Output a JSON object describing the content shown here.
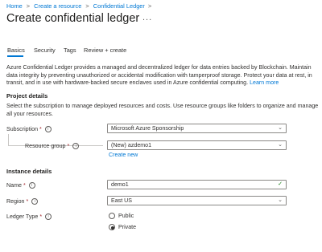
{
  "breadcrumb": {
    "items": [
      "Home",
      "Create a resource",
      "Confidential Ledger"
    ],
    "separator": ">",
    "trailing": ">"
  },
  "page": {
    "title": "Create confidential ledger",
    "more_actions": "..."
  },
  "tabs": [
    {
      "label": "Basics",
      "active": true
    },
    {
      "label": "Security",
      "active": false
    },
    {
      "label": "Tags",
      "active": false
    },
    {
      "label": "Review + create",
      "active": false
    }
  ],
  "description": {
    "text": "Azure Confidential Ledger provides a managed and decentralized ledger for data entries backed by Blockchain. Maintain data integrity by preventing unauthorized or accidental modification with tamperproof storage. Protect your data at rest, in transit, and in use with hardware-backed secure enclaves used in Azure confidential computing.",
    "learn_more": "Learn more"
  },
  "project_details": {
    "heading": "Project details",
    "text": "Select the subscription to manage deployed resources and costs. Use resource groups like folders to organize and manage all your resources.",
    "subscription": {
      "label": "Subscription",
      "value": "Microsoft Azure Sponsorship"
    },
    "resource_group": {
      "label": "Resource group",
      "value": "(New) azdemo1",
      "create_new": "Create new"
    }
  },
  "instance_details": {
    "heading": "Instance details",
    "name": {
      "label": "Name",
      "value": "demo1"
    },
    "region": {
      "label": "Region",
      "value": "East US"
    },
    "ledger_type": {
      "label": "Ledger Type",
      "options": [
        {
          "label": "Public",
          "selected": false
        },
        {
          "label": "Private",
          "selected": true
        }
      ]
    }
  },
  "required_marker": "*",
  "info_glyph": "i",
  "colors": {
    "accent": "#0078d4",
    "required": "#a4262c",
    "text": "#323130"
  }
}
